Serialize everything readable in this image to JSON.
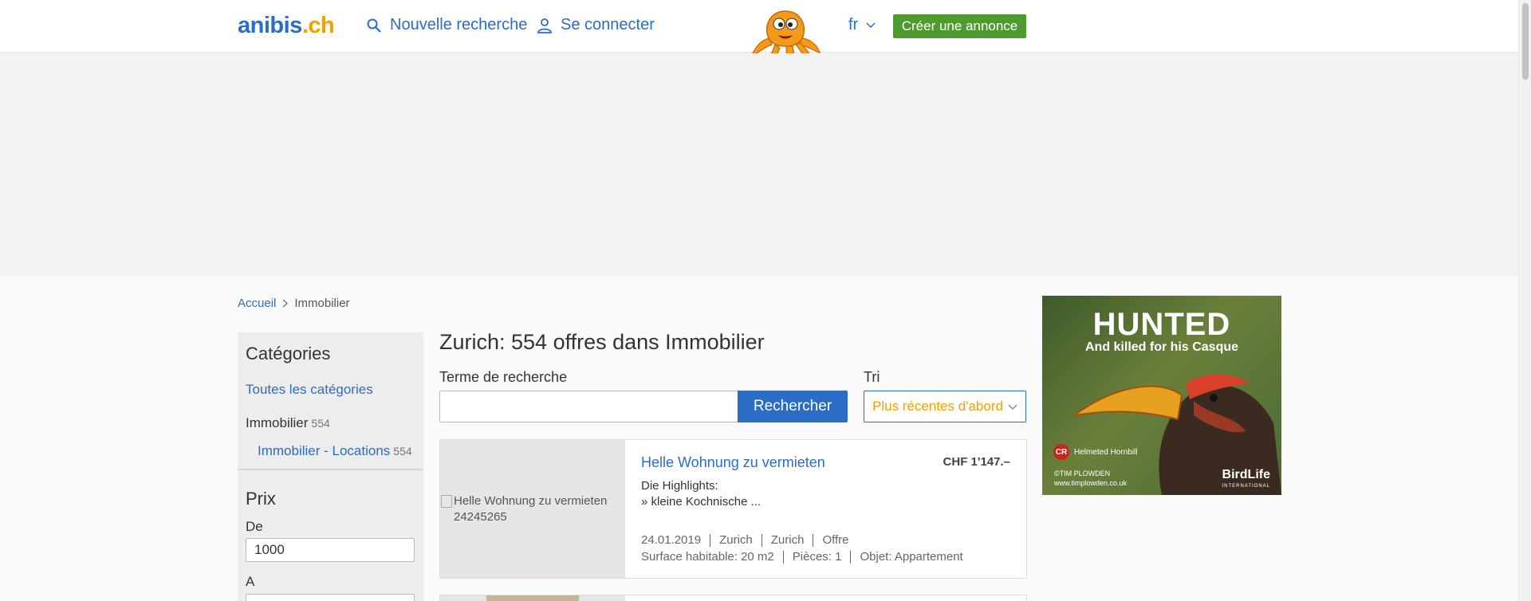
{
  "header": {
    "logo_main": "anibis",
    "logo_tld": ".ch",
    "new_search": "Nouvelle recherche",
    "login": "Se connecter",
    "language": "fr",
    "create_ad": "Créer une annonce"
  },
  "breadcrumb": {
    "home": "Accueil",
    "current": "Immobilier"
  },
  "sidebar": {
    "title": "Catégories",
    "all_categories": "Toutes les catégories",
    "category": {
      "label": "Immobilier",
      "count": "554"
    },
    "subcategory": {
      "label": "Immobilier - Locations",
      "count": "554"
    },
    "price_title": "Prix",
    "from_label": "De",
    "from_value": "1000",
    "to_label": "A"
  },
  "main": {
    "title": "Zurich: 554 offres dans Immobilier",
    "search_label": "Terme de recherche",
    "search_value": "",
    "search_button": "Rechercher",
    "sort_label": "Tri",
    "sort_value": "Plus récentes d'abord"
  },
  "listings": [
    {
      "image_alt": "Helle Wohnung zu vermieten 24245265",
      "title": "Helle Wohnung zu vermieten",
      "price": "CHF 1'147.–",
      "desc_line1": "Die Highlights:",
      "desc_line2": "» kleine Kochnische ...",
      "date": "24.01.2019",
      "region": "Zurich",
      "city": "Zurich",
      "type": "Offre",
      "surface": "Surface habitable: 20 m2",
      "rooms": "Pièces: 1",
      "object": "Objet: Appartement"
    }
  ],
  "ad": {
    "headline": "HUNTED",
    "subline": "And killed for his Casque",
    "status_badge": "CR",
    "species": "Helmeted Hornbill",
    "credit_1": "©TIM PLOWDEN",
    "credit_2": "www.timplowden.co.uk",
    "brand": "BirdLife",
    "brand_sub": "INTERNATIONAL"
  },
  "colors": {
    "link": "#2b6cc4",
    "accent": "#f0a000",
    "create_button": "#4e9a2e"
  }
}
